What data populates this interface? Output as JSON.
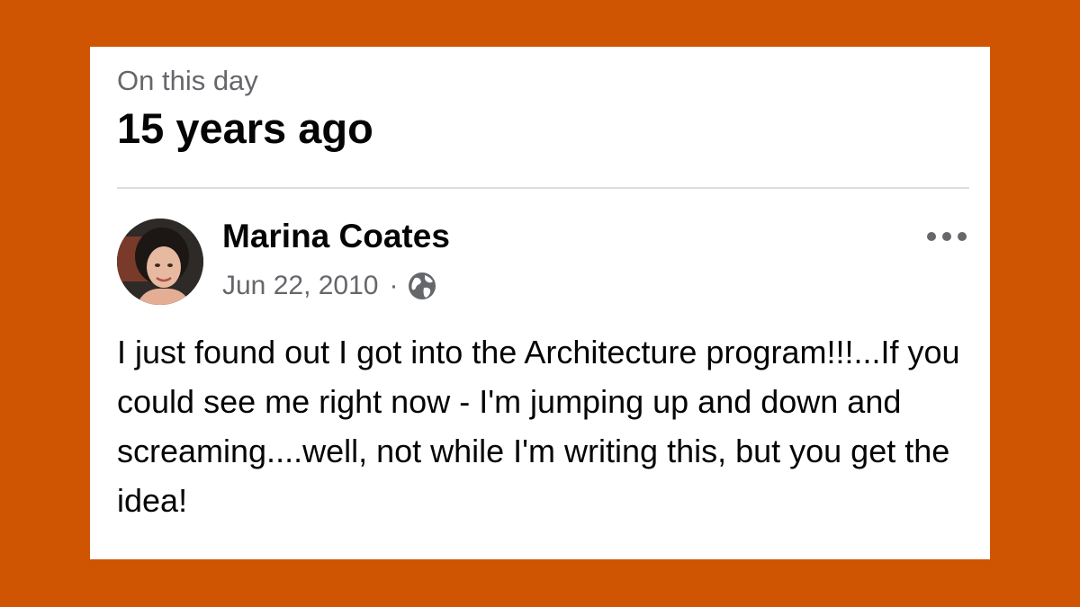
{
  "memory": {
    "label": "On this day",
    "title": "15 years ago"
  },
  "post": {
    "author": "Marina Coates",
    "date": "Jun 22, 2010",
    "separator": "·",
    "audience_icon": "globe-icon",
    "more_icon": "more-options-icon",
    "text": "I just found out I got into the Architecture program!!!...If you could see me right now - I'm jumping up and down and screaming....well, not while I'm writing this, but you get the idea!"
  },
  "colors": {
    "frame": "#cf5502",
    "card": "#ffffff",
    "primary_text": "#050505",
    "secondary_text": "#65676b",
    "divider": "#dadde1"
  }
}
